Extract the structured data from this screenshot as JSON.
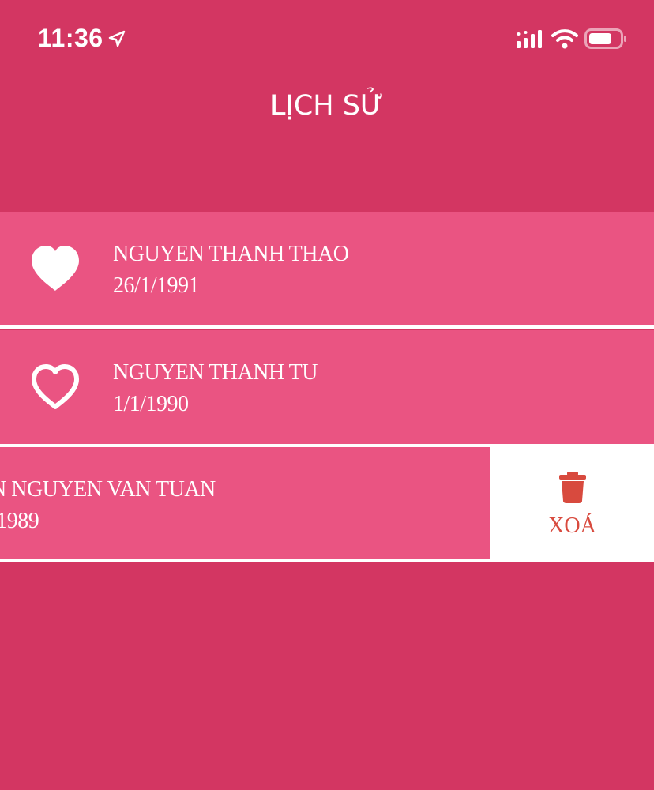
{
  "status_bar": {
    "time": "11:36",
    "icons": [
      "location-arrow-icon",
      "cellular-signal-icon",
      "wifi-icon",
      "battery-icon"
    ]
  },
  "header": {
    "title": "LỊCH SỬ"
  },
  "history": {
    "items": [
      {
        "name": "NGUYEN THANH THAO",
        "dob": "26/1/1991",
        "favorite": true
      },
      {
        "name": "NGUYEN THANH TU",
        "dob": "1/1/1990",
        "favorite": false
      },
      {
        "name": "N NGUYEN VAN TUAN",
        "dob": "/1989",
        "favorite": false
      }
    ]
  },
  "swipe_action": {
    "delete_label": "XOÁ"
  },
  "colors": {
    "background": "#D33662",
    "row": "#EA5482",
    "delete_text": "#D84A3E"
  }
}
